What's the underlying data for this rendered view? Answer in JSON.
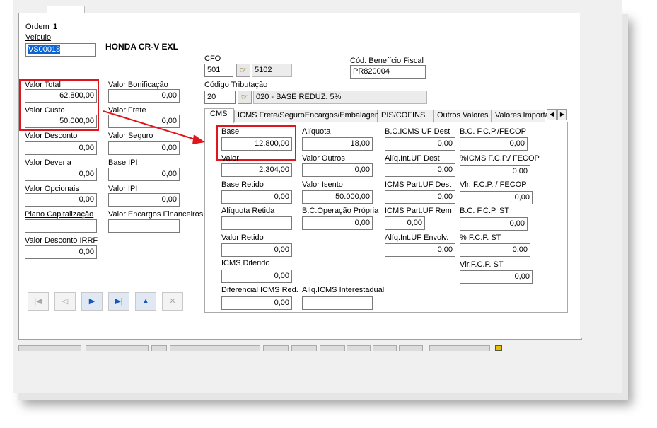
{
  "header": {
    "ordem_label": "Ordem",
    "ordem_value": "1",
    "veiculo_label": "Veículo",
    "veiculo_value": "VS00018",
    "veiculo_desc": "HONDA CR-V EXL"
  },
  "left": {
    "valor_total": {
      "label": "Valor Total",
      "value": "62.800,00"
    },
    "valor_custo": {
      "label": "Valor Custo",
      "value": "50.000,00"
    },
    "valor_desconto": {
      "label": "Valor Desconto",
      "value": "0,00"
    },
    "valor_deveria": {
      "label": "Valor Deveria",
      "value": "0,00"
    },
    "valor_opcionais": {
      "label": "Valor Opcionais",
      "value": "0,00"
    },
    "plano_capitalizacao": {
      "label": "Plano Capitalização",
      "value": ""
    },
    "valor_desconto_irrf": {
      "label": "Valor Desconto IRRF",
      "value": "0,00"
    }
  },
  "mid": {
    "valor_bonificacao": {
      "label": "Valor Bonificação",
      "value": "0,00"
    },
    "valor_frete": {
      "label": "Valor Frete",
      "value": "0,00"
    },
    "valor_seguro": {
      "label": "Valor Seguro",
      "value": "0,00"
    },
    "base_ipi": {
      "label": "Base IPI",
      "value": "0,00"
    },
    "valor_ipi": {
      "label": "Valor IPI",
      "value": "0,00"
    },
    "valor_encargos": {
      "label": "Valor Encargos Financeiros",
      "value": ""
    }
  },
  "fiscal": {
    "cfo_label": "CFO",
    "cfo_value": "501",
    "cfo_desc": "5102",
    "beneficio_label": "Cód. Benefício Fiscal",
    "beneficio_value": "PR820004",
    "tributacao_label": "Código Tributação",
    "tributacao_value": "20",
    "tributacao_desc": "020 - BASE REDUZ. 5%"
  },
  "tabs": [
    "ICMS",
    "ICMS Frete/SeguroEncargos/Embalagem",
    "PIS/COFINS",
    "Outros Valores",
    "Valores Importa"
  ],
  "icms": {
    "base": {
      "label": "Base",
      "value": "12.800,00"
    },
    "valor": {
      "label": "Valor",
      "value": "2.304,00"
    },
    "base_retido": {
      "label": "Base Retido",
      "value": "0,00"
    },
    "aliquota_retida": {
      "label": "Alíquota Retida",
      "value": ""
    },
    "valor_retido": {
      "label": "Valor Retido",
      "value": "0,00"
    },
    "icms_diferido": {
      "label": "ICMS Diferido",
      "value": "0,00"
    },
    "diferencial_icms_red": {
      "label": "Diferencial ICMS Red.",
      "value": "0,00"
    },
    "aliquota": {
      "label": "Alíquota",
      "value": "18,00"
    },
    "valor_outros": {
      "label": "Valor Outros",
      "value": "0,00"
    },
    "valor_isento": {
      "label": "Valor Isento",
      "value": "50.000,00"
    },
    "bc_operacao_propria": {
      "label": "B.C.Operação Própria",
      "value": "0,00"
    },
    "aliq_icms_interestadual": {
      "label": "Alíq.ICMS Interestadual",
      "value": ""
    },
    "bc_icms_uf_dest": {
      "label": "B.C.ICMS UF Dest",
      "value": "0,00"
    },
    "aliq_int_uf_dest": {
      "label": "Alíq.Int.UF Dest",
      "value": "0,00"
    },
    "icms_part_uf_dest": {
      "label": "ICMS Part.UF Dest",
      "value": "0,00"
    },
    "icms_part_uf_rem": {
      "label": "ICMS Part.UF Rem",
      "value": "0,00"
    },
    "aliq_int_uf_envolv": {
      "label": "Alíq.Int.UF Envolv.",
      "value": "0,00"
    },
    "bc_fcp_fecop": {
      "label": "B.C. F.C.P./FECOP",
      "value": "0,00"
    },
    "pct_icms_fcp_fecop": {
      "label": "%ICMS F.C.P./ FECOP",
      "value": "0,00"
    },
    "vlr_fcp_fecop": {
      "label": "Vlr. F.C.P. / FECOP",
      "value": "0,00"
    },
    "bc_fcp_st": {
      "label": "B.C. F.C.P. ST",
      "value": "0,00"
    },
    "pct_fcp_st": {
      "label": "% F.C.P. ST",
      "value": "0,00"
    },
    "vlr_fcp_st": {
      "label": "Vlr.F.C.P. ST",
      "value": "0,00"
    }
  },
  "icons": {
    "lookup": "pointing-hand-icon",
    "first": "skip-first-icon",
    "prev": "prev-icon",
    "next": "next-icon",
    "last": "skip-last-icon",
    "up": "up-icon",
    "cancel": "cancel-icon"
  },
  "colors": {
    "highlight": "#e0161c",
    "selection": "#0a64d2"
  }
}
